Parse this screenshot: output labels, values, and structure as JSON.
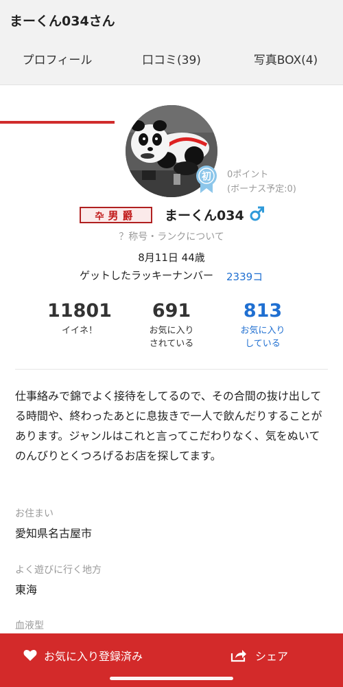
{
  "header": {
    "title": "まーくん034さん"
  },
  "tabs": [
    {
      "label": "プロフィール",
      "active": true
    },
    {
      "label": "口コミ(39)"
    },
    {
      "label": "写真BOX(4)"
    }
  ],
  "profile": {
    "avatar_icon": "panda-toy-photo",
    "badge_label": "初",
    "points": "0ポイント",
    "bonus": "(ボーナス予定:0)",
    "rank_mark": "卆",
    "rank_title": "男爵",
    "username": "まーくん034",
    "gender_icon": "male-symbol-icon",
    "rank_help": "？称号・ランクについて",
    "birthday_age": "8月11日 44歳",
    "lucky_label": "ゲットしたラッキーナンバー",
    "lucky_value": "2339コ"
  },
  "stats": [
    {
      "value": "11801",
      "label_lines": [
        "イイネ！"
      ]
    },
    {
      "value": "691",
      "label_lines": [
        "お気に入り",
        "されている"
      ]
    },
    {
      "value": "813",
      "label_lines": [
        "お気に入り",
        "している"
      ]
    }
  ],
  "bio": "仕事絡みで錦でよく接待をしてるので、その合間の抜け出してる時間や、終わったあとに息抜きで一人で飲んだりすることがあります。ジャンルはこれと言ってこだわりなく、気をぬいてのんびりとくつろげるお店を探してます。",
  "fields": [
    {
      "label": "お住まい",
      "value": "愛知県名古屋市"
    },
    {
      "label": "よく遊びに行く地方",
      "value": "東海"
    },
    {
      "label": "血液型",
      "value": ""
    }
  ],
  "bottom_bar": {
    "favorite_label": "お気に入り登録済み",
    "share_label": "シェア"
  },
  "colors": {
    "accent_red": "#d32a2a",
    "link_blue": "#1f6fd1",
    "gender_blue": "#2f9ad9",
    "badge_blue": "#8cc6ea"
  }
}
